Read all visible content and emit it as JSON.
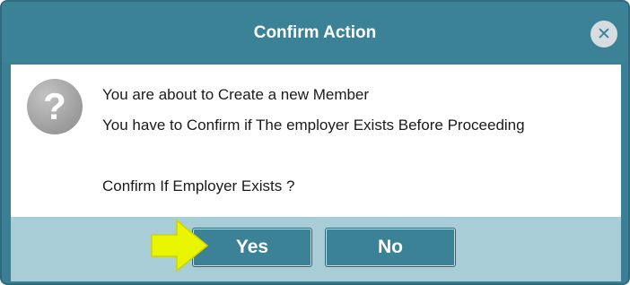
{
  "dialog": {
    "title": "Confirm Action",
    "close_icon": "close-circle-icon",
    "question_icon": "question-mark-icon",
    "question_glyph": "?",
    "messages": [
      "You are about to Create a new Member",
      "You have to Confirm if The employer Exists Before Proceeding",
      "Confirm If Employer Exists ?"
    ],
    "buttons": {
      "yes_label": "Yes",
      "no_label": "No"
    },
    "highlight_arrow_icon": "pointer-arrow-icon"
  },
  "colors": {
    "titlebar": "#3b8297",
    "footer": "#a9cdd6",
    "button": "#3b8297",
    "arrow": "#e8f400"
  }
}
